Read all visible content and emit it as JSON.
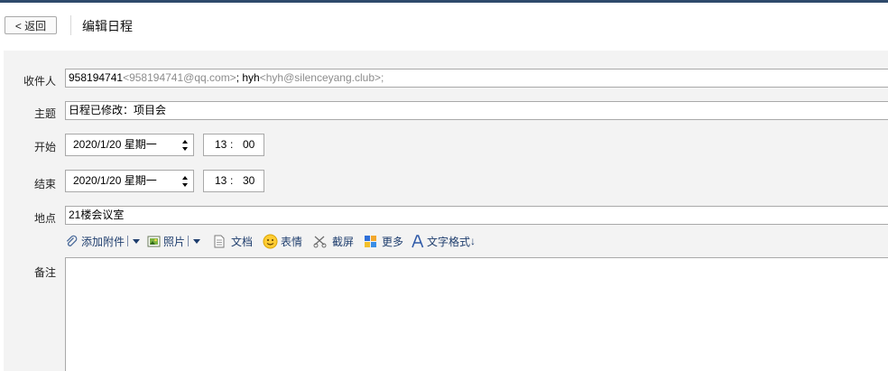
{
  "header": {
    "back_label": "< 返回",
    "title": "编辑日程"
  },
  "form": {
    "recipients_label": "收件人",
    "recipients": [
      {
        "name": "958194741",
        "email": "<958194741@qq.com>"
      },
      {
        "name": "hyh",
        "email": "<hyh@silenceyang.club>"
      }
    ],
    "recipient_separator": "; ",
    "subject_label": "主题",
    "subject_value": "日程已修改：项目会",
    "start_label": "开始",
    "start_date": "2020/1/20 星期一",
    "start_hour": "13",
    "start_minute": "00",
    "end_label": "结束",
    "end_date": "2020/1/20 星期一",
    "end_hour": "13",
    "end_minute": "30",
    "time_colon": ":",
    "location_label": "地点",
    "location_value": "21楼会议室",
    "notes_label": "备注"
  },
  "toolbar": {
    "attach": "添加附件",
    "photo": "照片",
    "document": "文档",
    "emoji": "表情",
    "screenshot": "截屏",
    "more": "更多",
    "text_format": "文字格式",
    "format_suffix": "↓"
  },
  "colors": {
    "top_border": "#2e4a6b",
    "panel_bg": "#f3f3f3",
    "toolbar_text": "#1f3e6e",
    "email_gray": "#8c8c8c"
  },
  "icons": [
    "paperclip-icon",
    "photo-icon",
    "document-icon",
    "smiley-icon",
    "scissors-icon",
    "grid-icon",
    "text-format-icon"
  ]
}
